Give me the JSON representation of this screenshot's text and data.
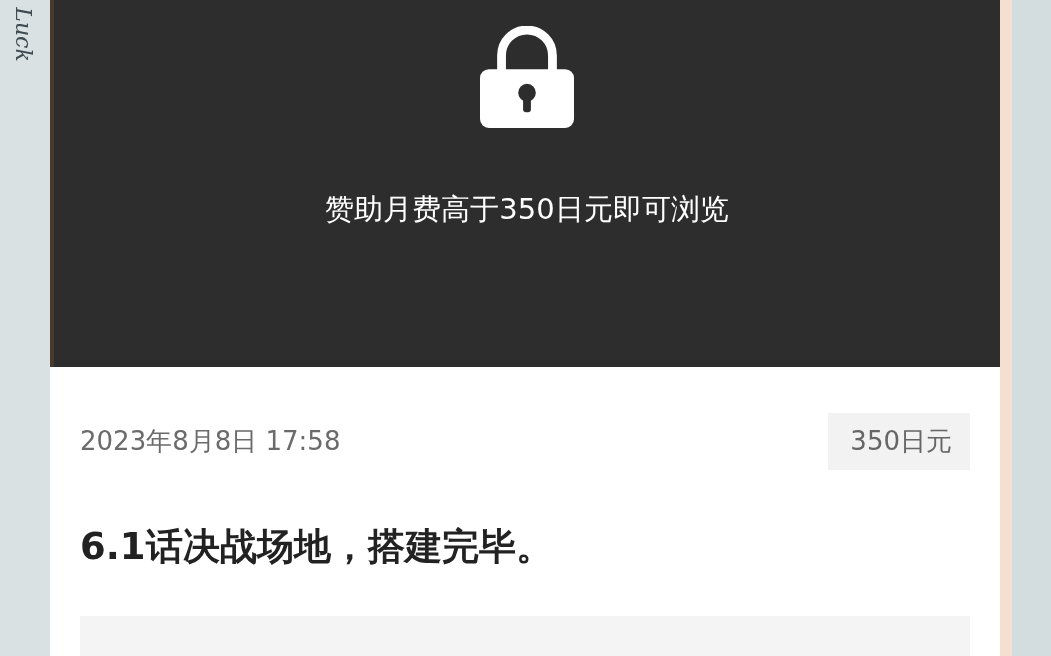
{
  "side_note": "Luck",
  "locked_panel": {
    "message": "赞助月费高于350日元即可浏览"
  },
  "post": {
    "date": "2023年8月8日 17:58",
    "price": "350日元",
    "title": "6.1话决战场地，搭建完毕。"
  }
}
